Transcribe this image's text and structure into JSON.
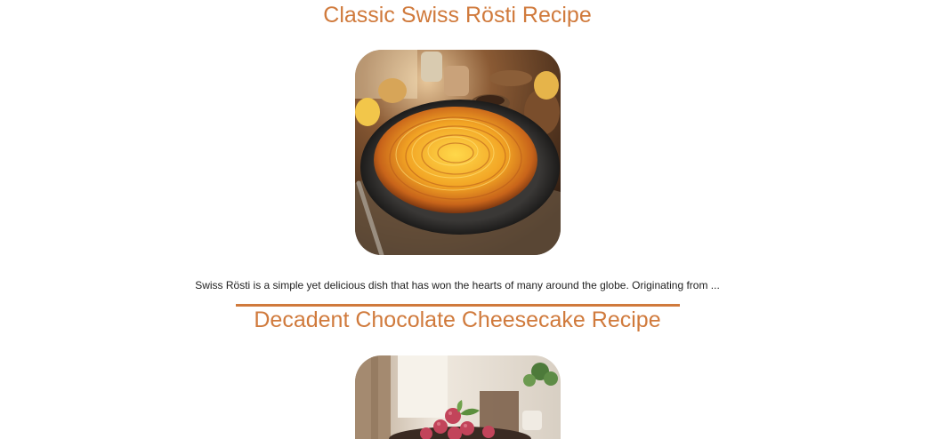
{
  "recipes": [
    {
      "title": "Classic Swiss Rösti Recipe",
      "excerpt": "Swiss Rösti is a simple yet delicious dish that has won the hearts of many around the globe. Originating from ..."
    },
    {
      "title": "Decadent Chocolate Cheesecake Recipe"
    }
  ],
  "colors": {
    "accent": "#d07a3c",
    "text": "#222222",
    "background": "#ffffff"
  }
}
